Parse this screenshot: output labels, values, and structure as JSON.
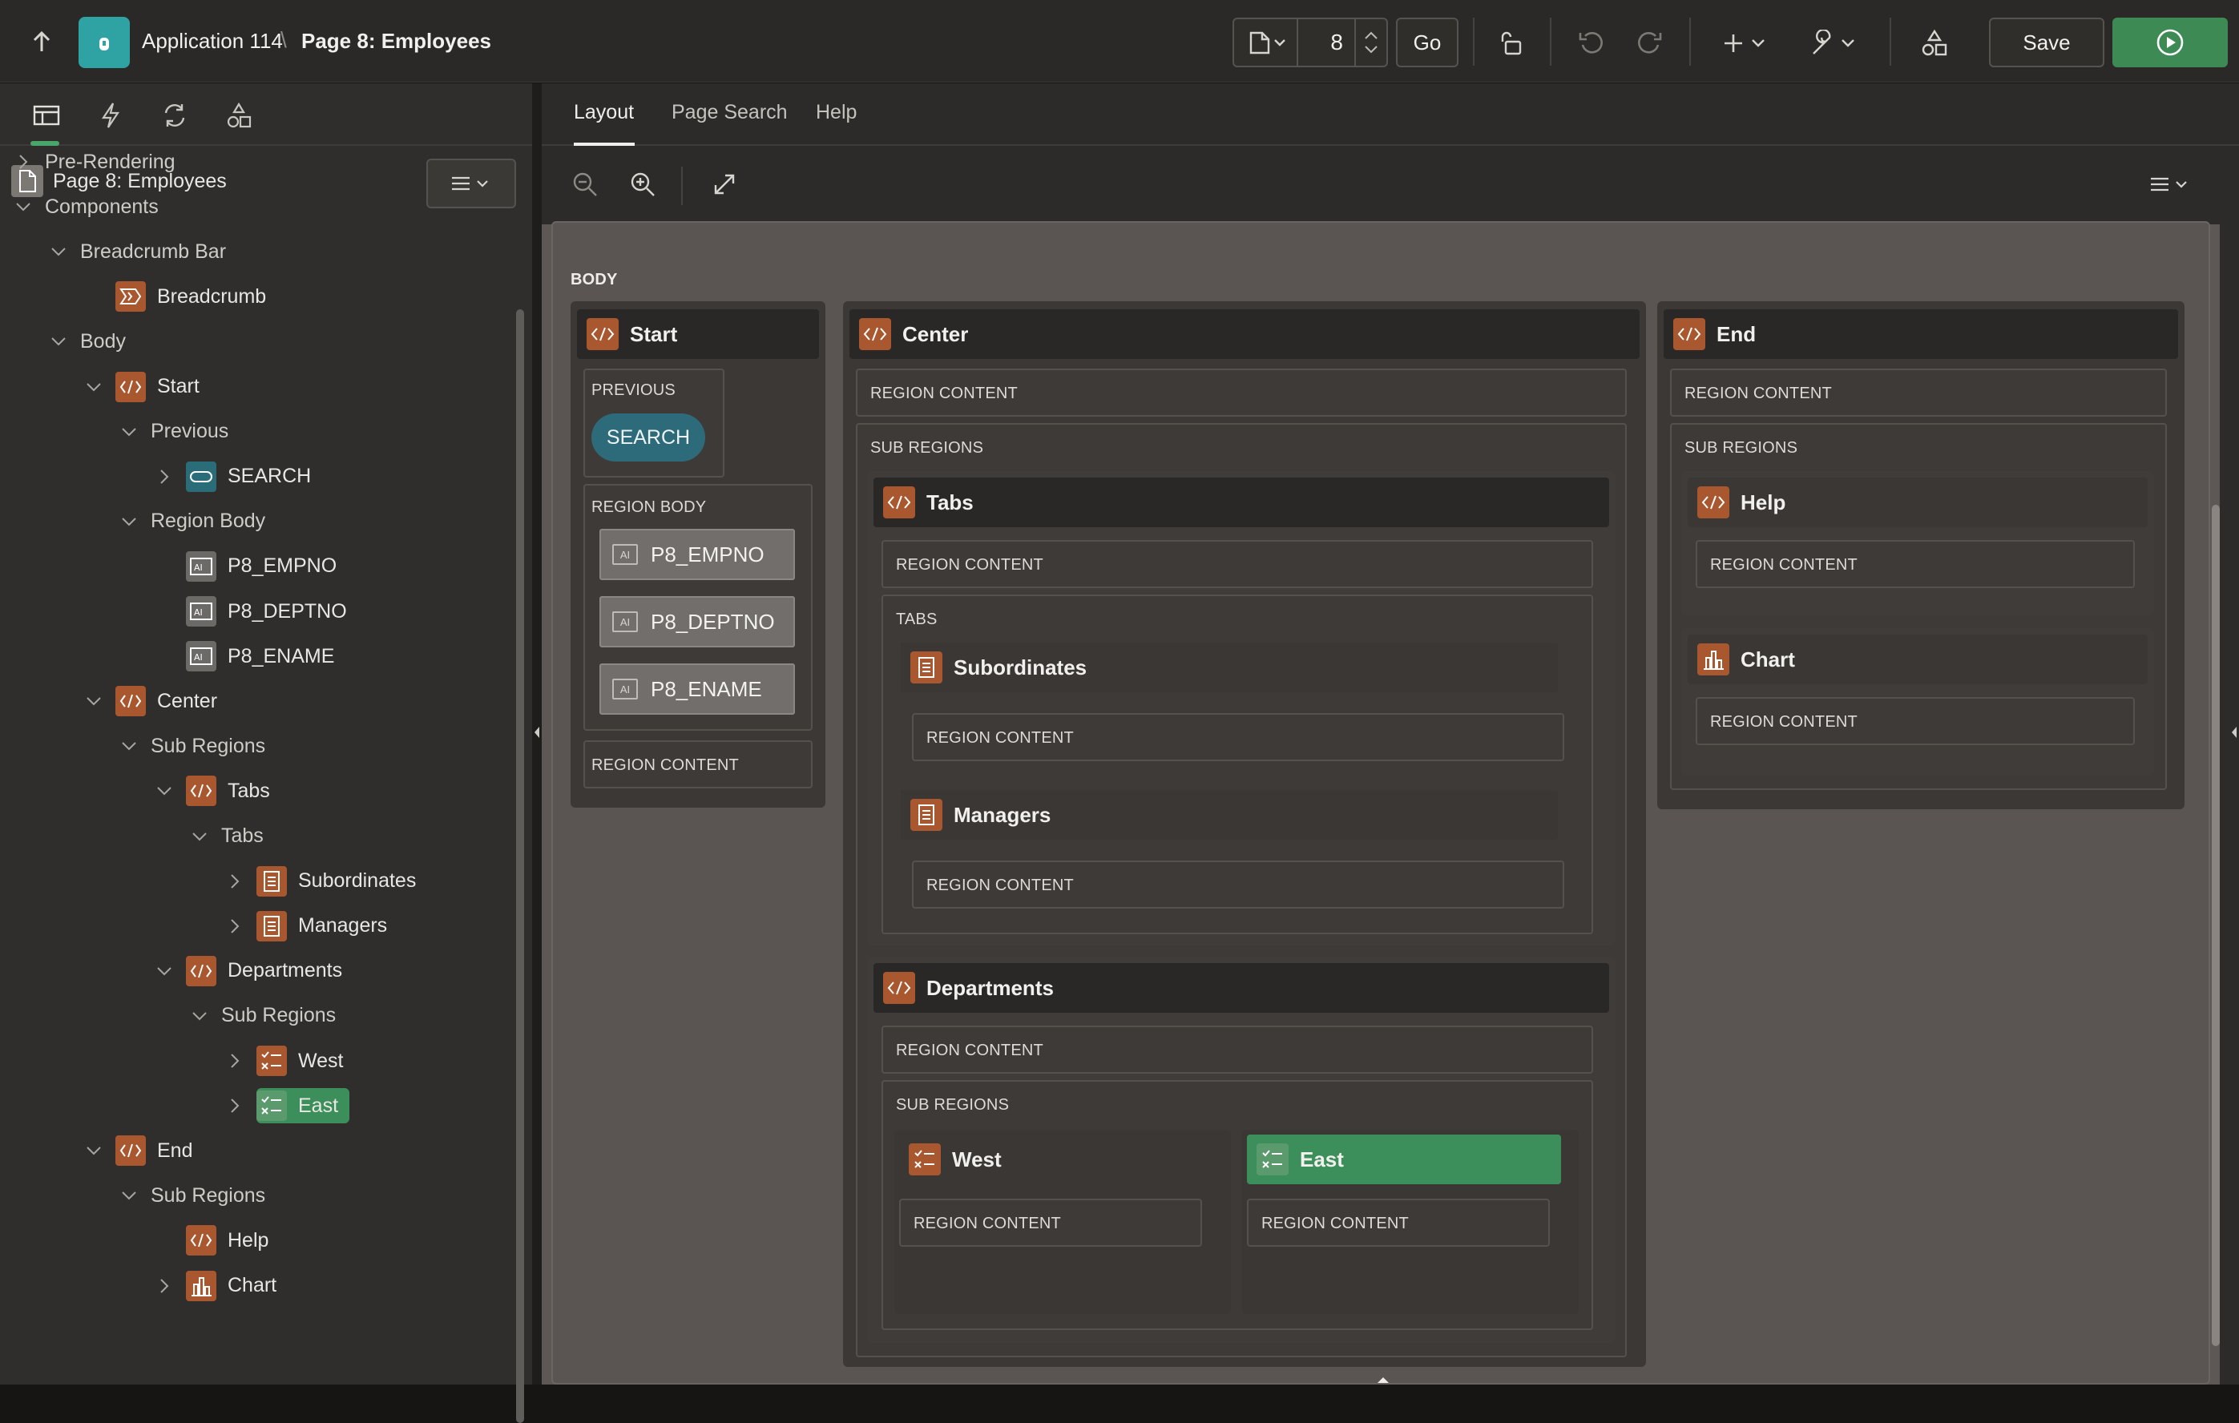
{
  "topbar": {
    "app_name": "Application 114",
    "separator": "\\",
    "page_name": "Page 8: Employees",
    "page_number": "8",
    "go_label": "Go",
    "save_label": "Save"
  },
  "left": {
    "tree": [
      {
        "label": "Page 8: Employees"
      },
      {
        "label": "Pre-Rendering"
      },
      {
        "label": "Components"
      },
      {
        "label": "Breadcrumb Bar"
      },
      {
        "label": "Breadcrumb"
      },
      {
        "label": "Body"
      },
      {
        "label": "Start"
      },
      {
        "label": "Previous"
      },
      {
        "label": "SEARCH"
      },
      {
        "label": "Region Body"
      },
      {
        "label": "P8_EMPNO"
      },
      {
        "label": "P8_DEPTNO"
      },
      {
        "label": "P8_ENAME"
      },
      {
        "label": "Center"
      },
      {
        "label": "Sub Regions"
      },
      {
        "label": "Tabs"
      },
      {
        "label": "Tabs"
      },
      {
        "label": "Subordinates"
      },
      {
        "label": "Managers"
      },
      {
        "label": "Departments"
      },
      {
        "label": "Sub Regions"
      },
      {
        "label": "West"
      },
      {
        "label": "East"
      },
      {
        "label": "End"
      },
      {
        "label": "Sub Regions"
      },
      {
        "label": "Help"
      },
      {
        "label": "Chart"
      }
    ]
  },
  "right": {
    "tabs": [
      "Layout",
      "Page Search",
      "Help"
    ],
    "body_label": "BODY",
    "region_content": "REGION CONTENT",
    "sub_regions": "SUB REGIONS",
    "previous": "PREVIOUS",
    "region_body": "REGION BODY",
    "tabs_label": "TABS",
    "search_button": "SEARCH",
    "items": [
      "P8_EMPNO",
      "P8_DEPTNO",
      "P8_ENAME"
    ],
    "regions": {
      "start": "Start",
      "center": "Center",
      "end": "End",
      "tabs": "Tabs",
      "subordinates": "Subordinates",
      "managers": "Managers",
      "departments": "Departments",
      "west": "West",
      "east": "East",
      "help": "Help",
      "chart": "Chart"
    }
  },
  "colors": {
    "accent_green": "#3c8f5a",
    "region_orange": "#a9572f",
    "button_teal": "#2e6b7a"
  }
}
